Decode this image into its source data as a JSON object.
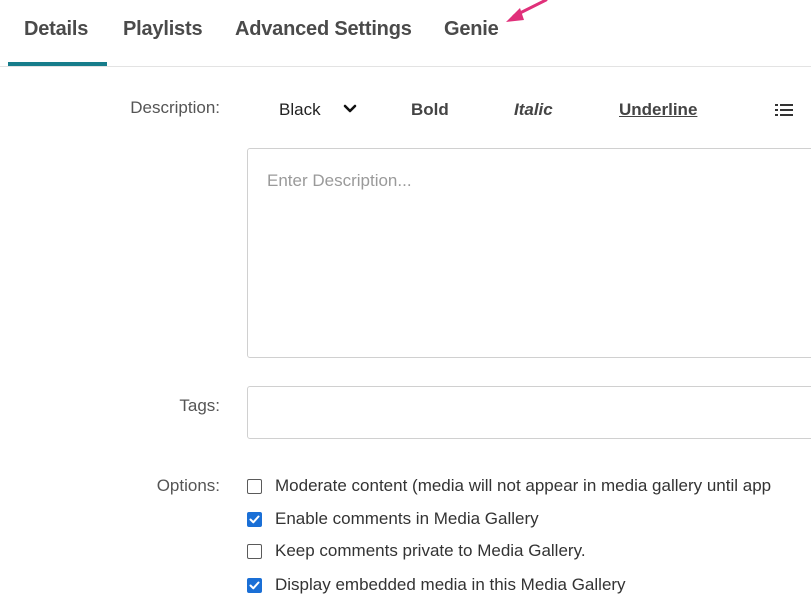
{
  "tabs": [
    {
      "label": "Details",
      "active": true
    },
    {
      "label": "Playlists",
      "active": false
    },
    {
      "label": "Advanced Settings",
      "active": false
    },
    {
      "label": "Genie",
      "active": false
    }
  ],
  "colors": {
    "accent": "#177d8b",
    "arrow": "#e0307a",
    "checkbox": "#1a6fd6"
  },
  "description": {
    "label": "Description:",
    "toolbar": {
      "color_select": "Black",
      "bold": "Bold",
      "italic": "Italic",
      "underline": "Underline",
      "list_icon": "list-icon"
    },
    "placeholder": "Enter Description..."
  },
  "tags": {
    "label": "Tags:",
    "value": ""
  },
  "options": {
    "label": "Options:",
    "items": [
      {
        "text": "Moderate content (media will not appear in media gallery until app",
        "checked": false
      },
      {
        "text": "Enable comments in Media Gallery",
        "checked": true
      },
      {
        "text": "Keep comments private to Media Gallery.",
        "checked": false
      },
      {
        "text": "Display embedded media in this Media Gallery",
        "checked": true
      }
    ]
  }
}
